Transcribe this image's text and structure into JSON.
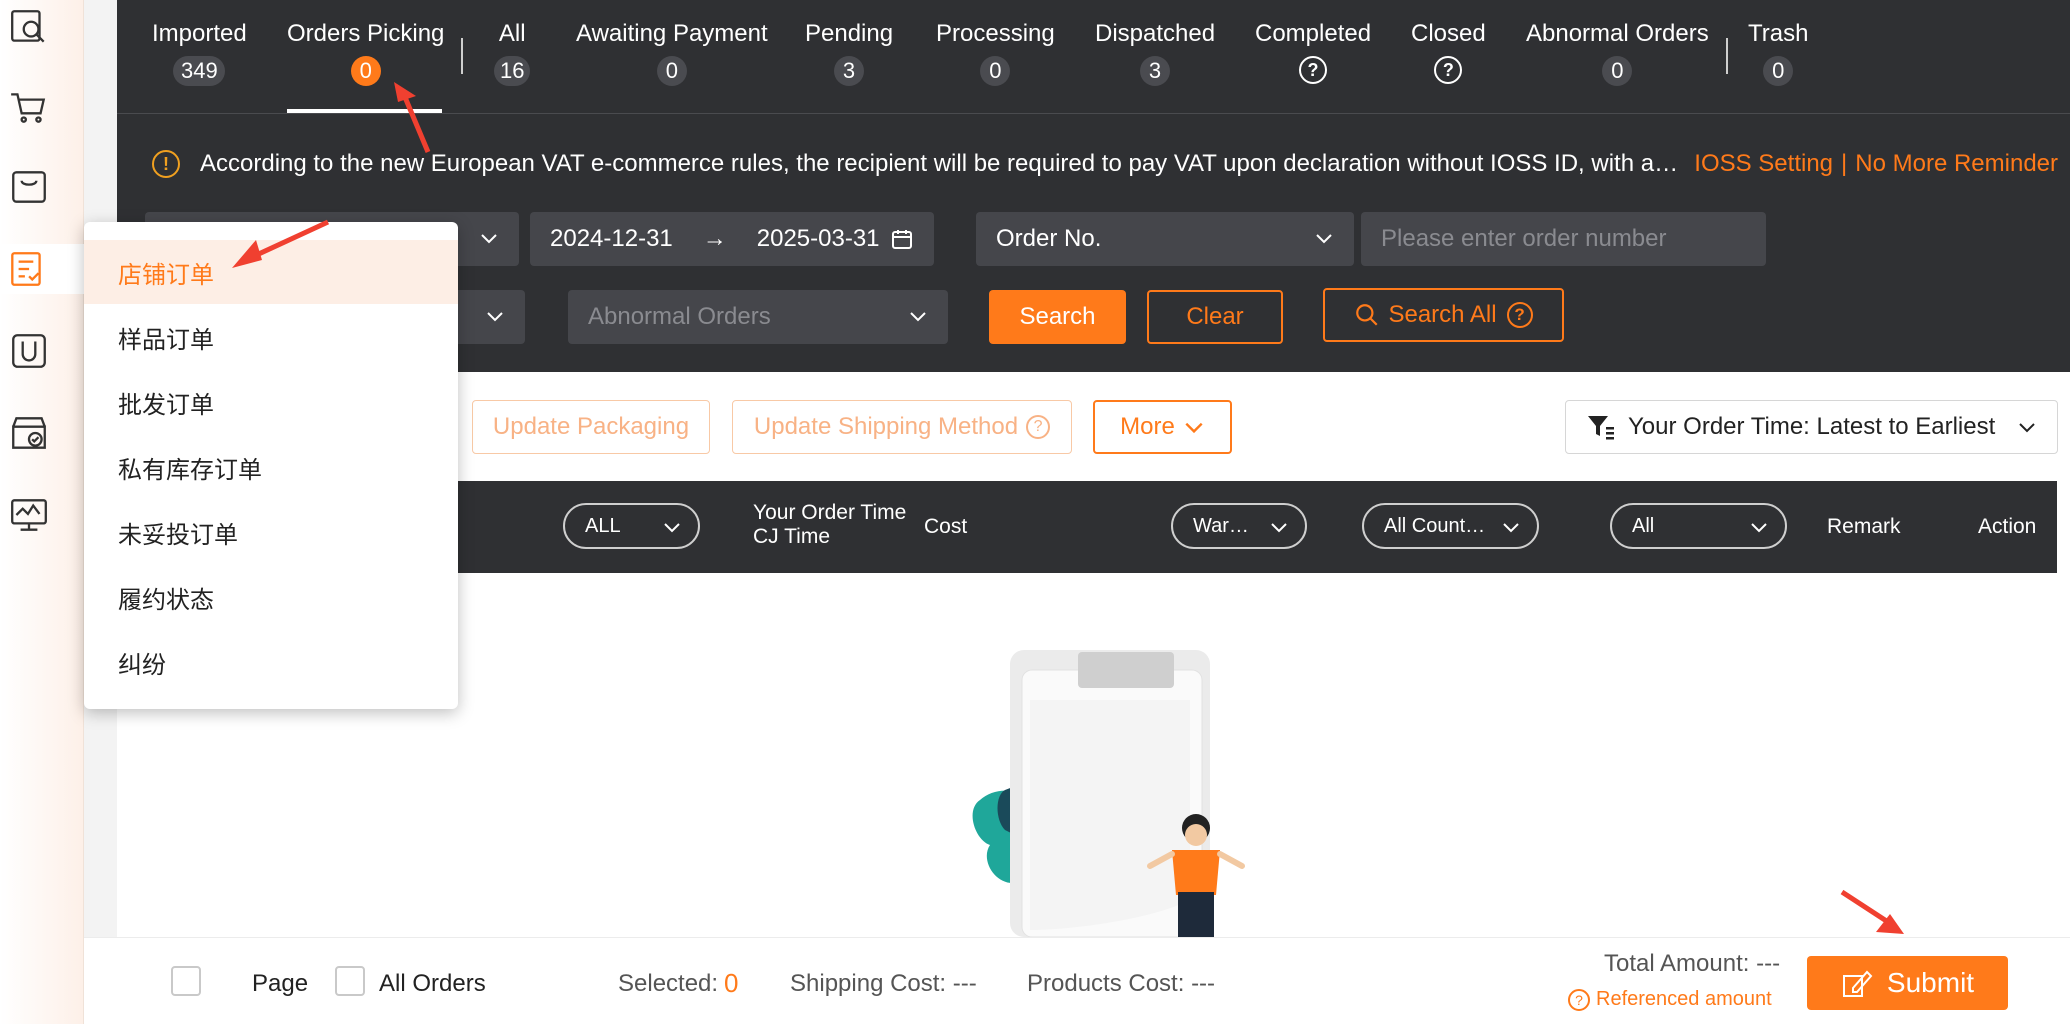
{
  "tabs": [
    {
      "label": "Imported",
      "count": "349"
    },
    {
      "label": "Orders Picking",
      "count": "0"
    },
    {
      "label": "All",
      "count": "16"
    },
    {
      "label": "Awaiting Payment",
      "count": "0"
    },
    {
      "label": "Pending",
      "count": "3"
    },
    {
      "label": "Processing",
      "count": "0"
    },
    {
      "label": "Dispatched",
      "count": "3"
    },
    {
      "label": "Completed",
      "count": "?"
    },
    {
      "label": "Closed",
      "count": "?"
    },
    {
      "label": "Abnormal Orders",
      "count": "0"
    },
    {
      "label": "Trash",
      "count": "0"
    }
  ],
  "notice": {
    "text": "According to the new European VAT e-commerce rules, the recipient will be required to pay VAT upon declaration without IOSS ID, with a…",
    "ioss_link": "IOSS Setting",
    "dismiss_link": "No More Reminder"
  },
  "filters": {
    "date_start": "2024-12-31",
    "date_end": "2025-03-31",
    "date_arrow": "→",
    "search_type": "Order No.",
    "order_placeholder": "Please enter order number",
    "abnormal_placeholder": "Abnormal Orders",
    "search_btn": "Search",
    "clear_btn": "Clear",
    "search_all_btn": "Search All"
  },
  "toolbar": {
    "update_packaging": "Update Packaging",
    "update_shipping": "Update Shipping Method",
    "more": "More",
    "sort": "Your Order Time: Latest to Earliest"
  },
  "table_header": {
    "all_pill": "ALL",
    "order_time": "Your Order Time",
    "cj_time": "CJ Time",
    "cost": "Cost",
    "warehouse_pill": "War…",
    "country_pill": "All Count…",
    "status_pill": "All",
    "remark": "Remark",
    "action": "Action"
  },
  "menu": [
    "店铺订单",
    "样品订单",
    "批发订单",
    "私有库存订单",
    "未妥投订单",
    "履约状态",
    "纠纷"
  ],
  "bottom": {
    "page_label": "Page",
    "all_orders_label": "All Orders",
    "selected_label": "Selected:",
    "selected_value": "0",
    "shipping_cost": "Shipping Cost: ---",
    "products_cost": "Products Cost: ---",
    "total_amount": "Total Amount: ---",
    "referenced": "Referenced amount",
    "submit": "Submit"
  },
  "colors": {
    "accent": "#ff7a1a",
    "dark": "#2f3033",
    "annotation": "#f04030"
  }
}
